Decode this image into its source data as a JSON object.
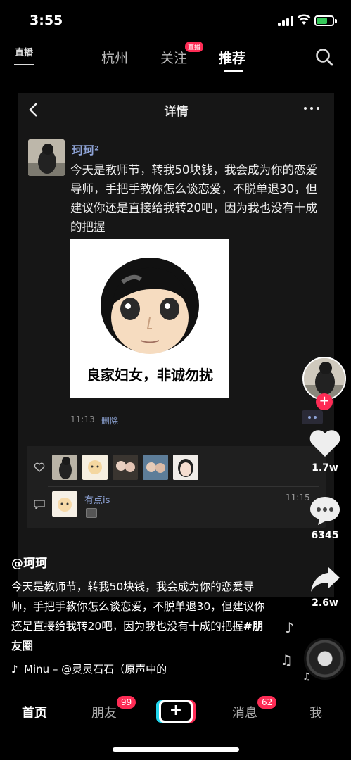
{
  "status_bar": {
    "time": "3:55",
    "battery_level": 0.7
  },
  "top_nav": {
    "live_label": "直播",
    "tabs": [
      {
        "label": "杭州"
      },
      {
        "label": "关注",
        "badge": "直播"
      },
      {
        "label": "推荐",
        "active": true
      }
    ]
  },
  "card": {
    "title": "详情",
    "post": {
      "author": "珂珂²",
      "text": "今天是教师节，转我50块钱，我会成为你的恋爱导师，手把手教你怎么谈恋爱，不脱单退30，但建议你还是直接给我转20吧，因为我也没有十成的把握",
      "meme_caption": "良家妇女，非诚勿扰",
      "time": "11:13",
      "delete_label": "删除"
    },
    "comment": {
      "name": "有点is",
      "time": "11:15"
    }
  },
  "right_rail": {
    "likes": "1.7w",
    "comments": "6345",
    "shares": "2.6w"
  },
  "video_info": {
    "author_handle": "@珂珂",
    "caption": "今天是教师节，转我50块钱，我会成为你的恋爱导师，手把手教你怎么谈恋爱，不脱单退30，但建议你还是直接给我转20吧，因为我也没有十成的把握",
    "hashtag": "#朋友圈",
    "music": "Minu – @灵灵石石（原声中的"
  },
  "bottom_nav": {
    "home": "首页",
    "friends": "朋友",
    "friends_badge": "99",
    "create": "+",
    "messages": "消息",
    "messages_badge": "62",
    "me": "我"
  },
  "colors": {
    "accent": "#fe2c55",
    "link": "#8ea3d6",
    "cyan": "#20d5ec"
  }
}
